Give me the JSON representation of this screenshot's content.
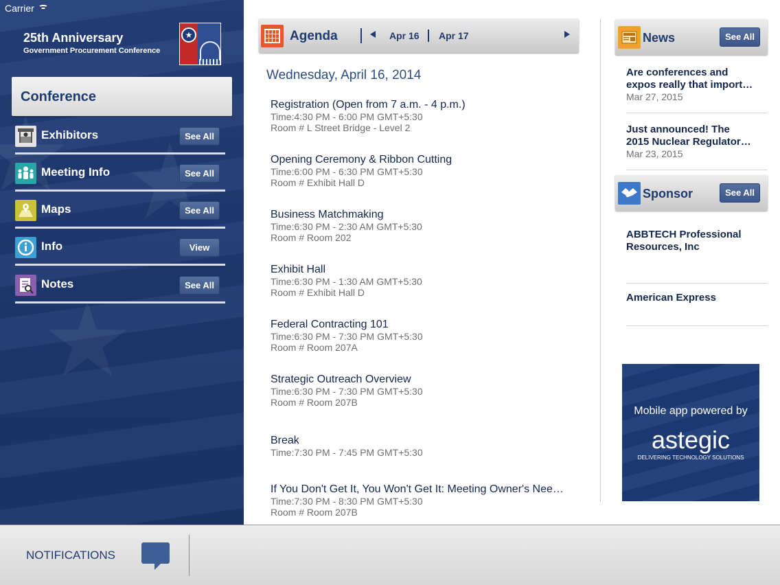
{
  "status_bar": {
    "carrier": "Carrier"
  },
  "brand": {
    "title": "25th Anniversary",
    "subtitle": "Government Procurement Conference"
  },
  "sidebar": {
    "section_title": "Conference",
    "items": [
      {
        "label": "Exhibitors",
        "button": "See All",
        "icon": "exhibitor-booth-icon",
        "color": "#d9d9d9"
      },
      {
        "label": "Meeting Info",
        "button": "See All",
        "icon": "people-group-icon",
        "color": "#2aa5a5"
      },
      {
        "label": "Maps",
        "button": "See All",
        "icon": "map-pin-icon",
        "color": "#c9c23a"
      },
      {
        "label": "Info",
        "button": "View",
        "icon": "info-icon",
        "color": "#3aa0d6"
      },
      {
        "label": "Notes",
        "button": "See All",
        "icon": "notes-icon",
        "color": "#8a5fb0"
      }
    ]
  },
  "agenda": {
    "title": "Agenda",
    "dates": [
      "Apr 16",
      "Apr 17"
    ],
    "day_heading": "Wednesday, April 16, 2014",
    "events": [
      {
        "title": "Registration (Open from 7 a.m. - 4 p.m.)",
        "time": "Time:4:30 PM - 6:00 PM GMT+5:30",
        "room": "Room # L Street Bridge - Level 2"
      },
      {
        "title": "Opening Ceremony & Ribbon Cutting",
        "time": "Time:6:00 PM - 6:30 PM GMT+5:30",
        "room": "Room # Exhibit Hall D"
      },
      {
        "title": "Business Matchmaking",
        "time": "Time:6:30 PM - 2:30 AM GMT+5:30",
        "room": "Room # Room 202"
      },
      {
        "title": "Exhibit Hall",
        "time": "Time:6:30 PM - 1:30 AM GMT+5:30",
        "room": "Room # Exhibit Hall D"
      },
      {
        "title": "Federal Contracting 101",
        "time": "Time:6:30 PM - 7:30 PM GMT+5:30",
        "room": "Room # Room 207A"
      },
      {
        "title": "Strategic Outreach Overview",
        "time": "Time:6:30 PM - 7:30 PM GMT+5:30",
        "room": "Room # Room 207B"
      },
      {
        "title": "Break",
        "time": "Time:7:30 PM - 7:45 PM GMT+5:30",
        "room": ""
      },
      {
        "title": "If You Don't Get It, You Won't Get It: Meeting Owner's Nee…",
        "time": "Time:7:30 PM - 8:30 PM GMT+5:30",
        "room": "Room # Room 207B"
      }
    ]
  },
  "news": {
    "title": "News",
    "button": "See All",
    "items": [
      {
        "line1": "Are conferences and",
        "line2": "expos really that import…",
        "date": "Mar 27, 2015"
      },
      {
        "line1": "Just announced! The",
        "line2": "2015 Nuclear Regulator…",
        "date": "Mar 23, 2015"
      }
    ]
  },
  "sponsor": {
    "title": "Sponsor",
    "button": "See All",
    "items": [
      {
        "line1": "ABBTECH Professional",
        "line2": "Resources, Inc"
      },
      {
        "line1": "American Express",
        "line2": ""
      }
    ]
  },
  "ad": {
    "powered_by": "Mobile app powered by",
    "logo": "astegic",
    "tagline": "DELIVERING TECHNOLOGY SOLUTIONS"
  },
  "footer": {
    "notifications": "NOTIFICATIONS"
  },
  "colors": {
    "navy": "#1f3b6e",
    "sidebar": "#23407a",
    "button": "#3b5688",
    "calendar": "#e05a2b",
    "news_icon": "#f0a030",
    "sponsor_icon": "#3d79c6"
  }
}
